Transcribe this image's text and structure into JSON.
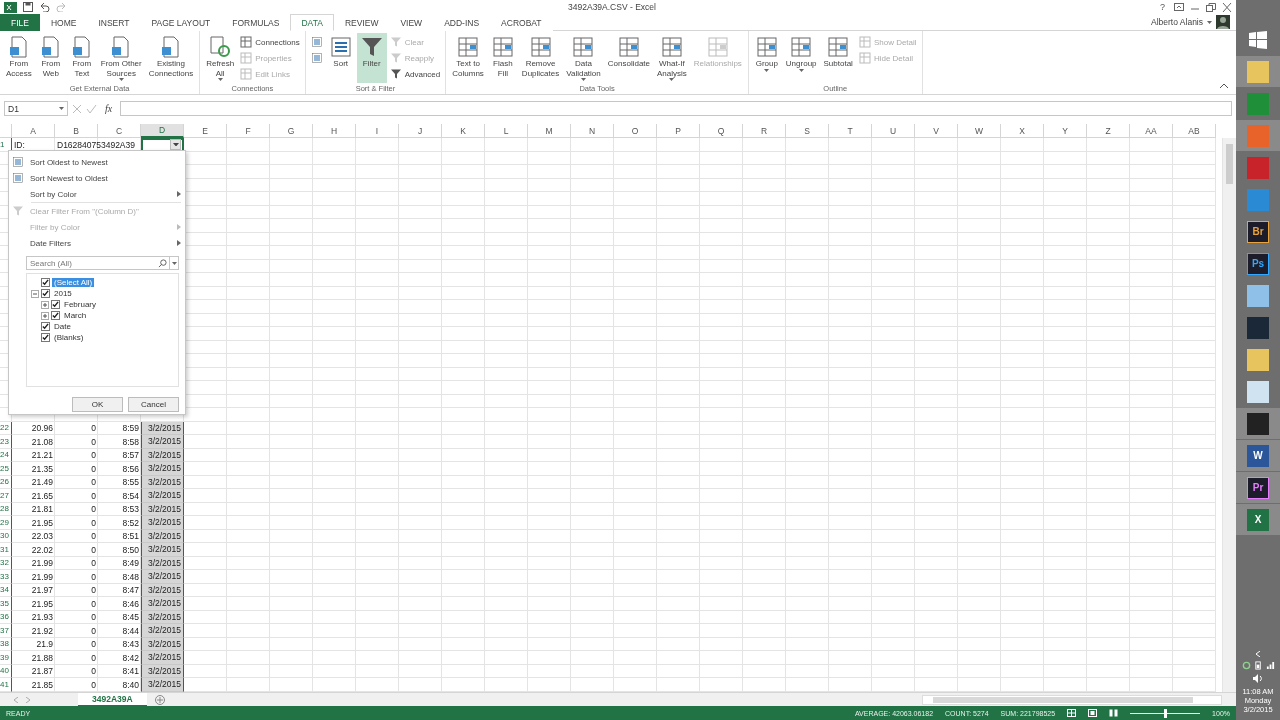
{
  "title_bar": {
    "title": "3492A39A.CSV - Excel",
    "help": "?"
  },
  "tabs": [
    {
      "label": "FILE",
      "kind": "file",
      "selected": false
    },
    {
      "label": "HOME",
      "kind": "tab",
      "selected": false
    },
    {
      "label": "INSERT",
      "kind": "tab",
      "selected": false
    },
    {
      "label": "PAGE LAYOUT",
      "kind": "tab",
      "selected": false
    },
    {
      "label": "FORMULAS",
      "kind": "tab",
      "selected": false
    },
    {
      "label": "DATA",
      "kind": "tab",
      "selected": true
    },
    {
      "label": "REVIEW",
      "kind": "tab",
      "selected": false
    },
    {
      "label": "VIEW",
      "kind": "tab",
      "selected": false
    },
    {
      "label": "ADD-INS",
      "kind": "tab",
      "selected": false
    },
    {
      "label": "ACROBAT",
      "kind": "tab",
      "selected": false
    }
  ],
  "account": {
    "name": "Alberto Alanis"
  },
  "ribbon_groups": [
    {
      "label": "Get External Data",
      "items": [
        {
          "kind": "large",
          "lines": [
            "From",
            "Access"
          ]
        },
        {
          "kind": "large",
          "lines": [
            "From",
            "Web"
          ]
        },
        {
          "kind": "large",
          "lines": [
            "From",
            "Text"
          ]
        },
        {
          "kind": "large",
          "lines": [
            "From Other",
            "Sources"
          ],
          "menu": true
        },
        {
          "kind": "large",
          "lines": [
            "Existing",
            "Connections"
          ]
        }
      ]
    },
    {
      "label": "Connections",
      "items": [
        {
          "kind": "large",
          "lines": [
            "Refresh",
            "All"
          ],
          "menu": true
        },
        {
          "kind": "stack",
          "items": [
            {
              "kind": "small",
              "label": "Connections",
              "disabled": false
            },
            {
              "kind": "small",
              "label": "Properties",
              "disabled": true
            },
            {
              "kind": "small",
              "label": "Edit Links",
              "disabled": true
            }
          ]
        }
      ]
    },
    {
      "label": "Sort & Filter",
      "items": [
        {
          "kind": "stack",
          "items": [
            {
              "kind": "small",
              "disabled": false
            },
            {
              "kind": "small",
              "disabled": false
            }
          ]
        },
        {
          "kind": "large",
          "lines": [
            "Sort"
          ]
        },
        {
          "kind": "large",
          "lines": [
            "Filter"
          ],
          "on": true
        },
        {
          "kind": "stack",
          "items": [
            {
              "kind": "small",
              "label": "Clear",
              "disabled": true
            },
            {
              "kind": "small",
              "label": "Reapply",
              "disabled": true
            },
            {
              "kind": "small",
              "label": "Advanced",
              "disabled": false
            }
          ]
        }
      ]
    },
    {
      "label": "Data Tools",
      "items": [
        {
          "kind": "large",
          "lines": [
            "Text to",
            "Columns"
          ]
        },
        {
          "kind": "large",
          "lines": [
            "Flash",
            "Fill"
          ]
        },
        {
          "kind": "large",
          "lines": [
            "Remove",
            "Duplicates"
          ]
        },
        {
          "kind": "large",
          "lines": [
            "Data",
            "Validation"
          ],
          "menu": true
        },
        {
          "kind": "large",
          "lines": [
            "Consolidate"
          ]
        },
        {
          "kind": "large",
          "lines": [
            "What-If",
            "Analysis"
          ],
          "menu": true
        },
        {
          "kind": "large",
          "lines": [
            "Relationships"
          ],
          "disabled": true
        }
      ]
    },
    {
      "label": "Outline",
      "items": [
        {
          "kind": "large",
          "lines": [
            "Group"
          ],
          "menu": true
        },
        {
          "kind": "large",
          "lines": [
            "Ungroup"
          ],
          "menu": true
        },
        {
          "kind": "large",
          "lines": [
            "Subtotal"
          ]
        },
        {
          "kind": "stack",
          "items": [
            {
              "kind": "small",
              "label": "Show Detail",
              "disabled": true
            },
            {
              "kind": "small",
              "label": "Hide Detail",
              "disabled": true
            }
          ]
        }
      ]
    }
  ],
  "formula_bar": {
    "name_box": "D1",
    "function_label": "fx"
  },
  "columns": [
    {
      "label": "A",
      "selected": false
    },
    {
      "label": "B",
      "selected": false
    },
    {
      "label": "C",
      "selected": false
    },
    {
      "label": "D",
      "selected": true
    },
    {
      "label": "E",
      "selected": false
    },
    {
      "label": "F",
      "selected": false
    },
    {
      "label": "G",
      "selected": false
    },
    {
      "label": "H",
      "selected": false
    },
    {
      "label": "I",
      "selected": false
    },
    {
      "label": "J",
      "selected": false
    },
    {
      "label": "K",
      "selected": false
    },
    {
      "label": "L",
      "selected": false
    },
    {
      "label": "M",
      "selected": false
    },
    {
      "label": "N",
      "selected": false
    },
    {
      "label": "O",
      "selected": false
    },
    {
      "label": "P",
      "selected": false
    },
    {
      "label": "Q",
      "selected": false
    },
    {
      "label": "R",
      "selected": false
    },
    {
      "label": "S",
      "selected": false
    },
    {
      "label": "T",
      "selected": false
    },
    {
      "label": "U",
      "selected": false
    },
    {
      "label": "V",
      "selected": false
    },
    {
      "label": "W",
      "selected": false
    },
    {
      "label": "X",
      "selected": false
    },
    {
      "label": "Y",
      "selected": false
    },
    {
      "label": "Z",
      "selected": false
    },
    {
      "label": "AA",
      "selected": false
    },
    {
      "label": "AB",
      "selected": false
    }
  ],
  "header_row": {
    "number": "1",
    "cells": [
      "ID:",
      "D162840753492A39"
    ],
    "filter_button": {
      "open": true
    }
  },
  "rows": [
    {
      "number": "22",
      "cells": [
        "20.96",
        "0",
        "8:59",
        "3/2/2015"
      ]
    },
    {
      "number": "23",
      "cells": [
        "21.08",
        "0",
        "8:58",
        "3/2/2015"
      ]
    },
    {
      "number": "24",
      "cells": [
        "21.21",
        "0",
        "8:57",
        "3/2/2015"
      ]
    },
    {
      "number": "25",
      "cells": [
        "21.35",
        "0",
        "8:56",
        "3/2/2015"
      ]
    },
    {
      "number": "26",
      "cells": [
        "21.49",
        "0",
        "8:55",
        "3/2/2015"
      ]
    },
    {
      "number": "27",
      "cells": [
        "21.65",
        "0",
        "8:54",
        "3/2/2015"
      ]
    },
    {
      "number": "28",
      "cells": [
        "21.81",
        "0",
        "8:53",
        "3/2/2015"
      ]
    },
    {
      "number": "29",
      "cells": [
        "21.95",
        "0",
        "8:52",
        "3/2/2015"
      ]
    },
    {
      "number": "30",
      "cells": [
        "22.03",
        "0",
        "8:51",
        "3/2/2015"
      ]
    },
    {
      "number": "31",
      "cells": [
        "22.02",
        "0",
        "8:50",
        "3/2/2015"
      ]
    },
    {
      "number": "32",
      "cells": [
        "21.99",
        "0",
        "8:49",
        "3/2/2015"
      ]
    },
    {
      "number": "33",
      "cells": [
        "21.99",
        "0",
        "8:48",
        "3/2/2015"
      ]
    },
    {
      "number": "34",
      "cells": [
        "21.97",
        "0",
        "8:47",
        "3/2/2015"
      ]
    },
    {
      "number": "35",
      "cells": [
        "21.95",
        "0",
        "8:46",
        "3/2/2015"
      ]
    },
    {
      "number": "36",
      "cells": [
        "21.93",
        "0",
        "8:45",
        "3/2/2015"
      ]
    },
    {
      "number": "37",
      "cells": [
        "21.92",
        "0",
        "8:44",
        "3/2/2015"
      ]
    },
    {
      "number": "38",
      "cells": [
        "21.9",
        "0",
        "8:43",
        "3/2/2015"
      ]
    },
    {
      "number": "39",
      "cells": [
        "21.88",
        "0",
        "8:42",
        "3/2/2015"
      ]
    },
    {
      "number": "40",
      "cells": [
        "21.87",
        "0",
        "8:41",
        "3/2/2015"
      ]
    },
    {
      "number": "41",
      "cells": [
        "21.85",
        "0",
        "8:40",
        "3/2/2015"
      ]
    }
  ],
  "filter_menu": {
    "items": [
      {
        "label": "Sort Oldest to Newest",
        "kind": "sort",
        "disabled": false,
        "submenu": false
      },
      {
        "label": "Sort Newest to Oldest",
        "kind": "sort",
        "disabled": false,
        "submenu": false
      },
      {
        "label": "Sort by Color",
        "kind": "plain",
        "disabled": false,
        "submenu": true
      },
      {
        "label": "Clear Filter From \"(Column D)\"",
        "kind": "clear",
        "disabled": true,
        "submenu": false
      },
      {
        "label": "Filter by Color",
        "kind": "plain",
        "disabled": true,
        "submenu": true
      },
      {
        "label": "Date Filters",
        "kind": "plain",
        "disabled": false,
        "submenu": true
      }
    ],
    "search": {
      "placeholder": "Search (All)"
    },
    "tree": [
      {
        "label": "(Select All)",
        "checked": true,
        "selected": true
      },
      {
        "label": "2015",
        "checked": true,
        "selected": false,
        "expanded": true,
        "children": [
          {
            "label": "February",
            "checked": true,
            "selected": false,
            "expanded": false
          },
          {
            "label": "March",
            "checked": true,
            "selected": false,
            "expanded": false
          }
        ]
      },
      {
        "label": "Date",
        "checked": true,
        "selected": false
      },
      {
        "label": "(Blanks)",
        "checked": true,
        "selected": false
      }
    ],
    "buttons": [
      "OK",
      "Cancel"
    ]
  },
  "sheet_tabs": [
    {
      "label": "3492A39A",
      "selected": true
    }
  ],
  "status_bar": {
    "mode": "READY",
    "stats": [
      "AVERAGE: 42063.06182",
      "COUNT: 5274",
      "SUM: 221798525"
    ],
    "zoom": {
      "level": 0.5,
      "label": "100%"
    }
  },
  "taskbar": {
    "apps": [
      {
        "kind": "windows",
        "selected": false
      },
      {
        "kind": "tile",
        "color": "#e8c45e",
        "selected": true
      },
      {
        "kind": "tile",
        "color": "#1f8f3a",
        "selected": false
      },
      {
        "kind": "tile",
        "color": "#e8632a",
        "selected": true
      },
      {
        "kind": "tile",
        "color": "#c8222a",
        "selected": false
      },
      {
        "kind": "tile",
        "color": "#2a8ad4",
        "selected": false
      },
      {
        "kind": "adobe",
        "color": "#e8a33d",
        "glyph": "Br",
        "selected": false
      },
      {
        "kind": "adobe",
        "color": "#31a8ff",
        "glyph": "Ps",
        "selected": false
      },
      {
        "kind": "tile",
        "color": "#8ec0e8",
        "selected": false
      },
      {
        "kind": "tile",
        "color": "#1b2838",
        "selected": false
      },
      {
        "kind": "tile",
        "color": "#e8c45e",
        "selected": false
      },
      {
        "kind": "tile",
        "color": "#cfe3f0",
        "selected": false
      },
      {
        "kind": "tile",
        "color": "#222222",
        "selected": true
      },
      {
        "kind": "tile",
        "color": "#2b579a",
        "glyph": "W",
        "selected": true
      },
      {
        "kind": "adobe",
        "color": "#e77cff",
        "glyph": "Pr",
        "selected": true
      },
      {
        "kind": "tile",
        "color": "#217346",
        "glyph": "X",
        "selected": true
      }
    ],
    "clock": {
      "time": "11:08 AM",
      "day": "Monday",
      "date": "3/2/2015"
    }
  }
}
